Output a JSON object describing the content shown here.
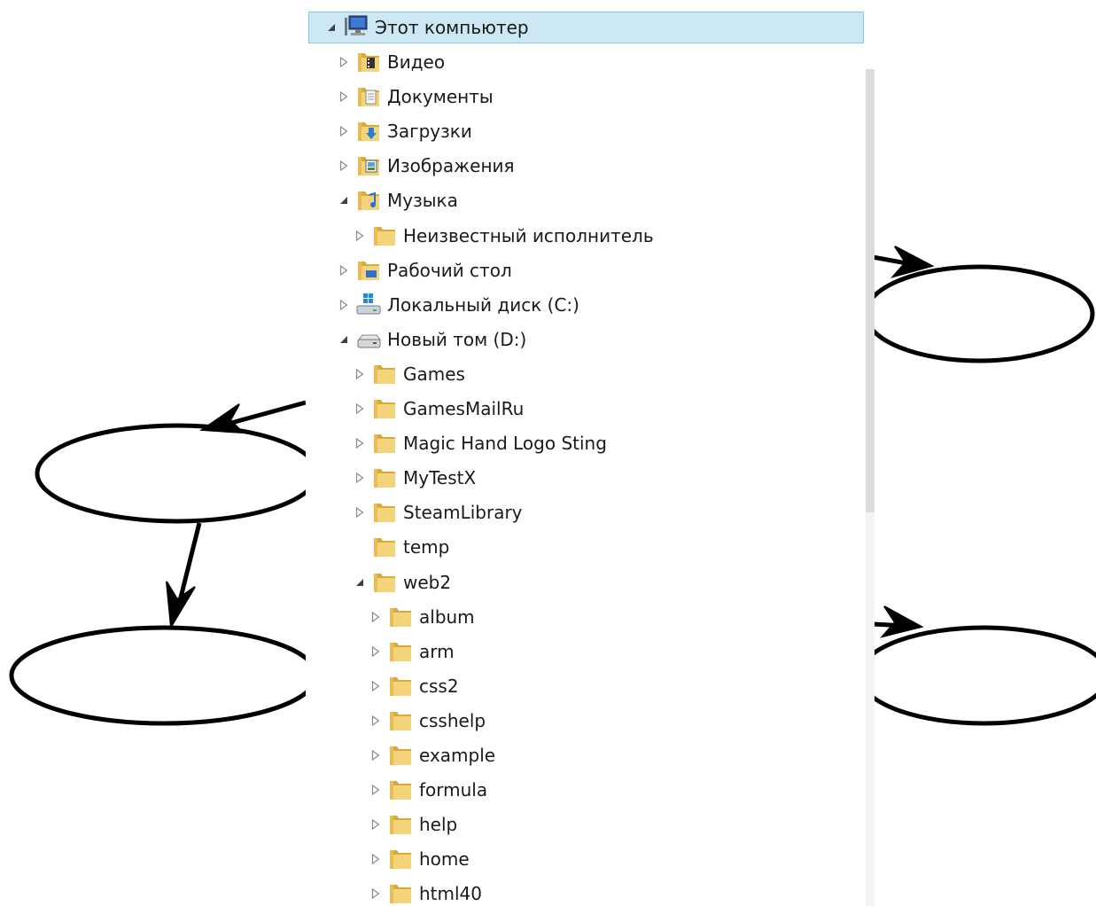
{
  "tree": {
    "root": {
      "label": "Этот компьютер",
      "icon": "computer-icon",
      "expanded": true
    },
    "items": [
      {
        "label": "Видео",
        "icon": "video-folder-icon",
        "arrow": "collapsed"
      },
      {
        "label": "Документы",
        "icon": "documents-folder-icon",
        "arrow": "collapsed"
      },
      {
        "label": "Загрузки",
        "icon": "downloads-folder-icon",
        "arrow": "collapsed"
      },
      {
        "label": "Изображения",
        "icon": "pictures-folder-icon",
        "arrow": "collapsed"
      },
      {
        "label": "Музыка",
        "icon": "music-folder-icon",
        "arrow": "expanded"
      },
      {
        "label": "Неизвестный исполнитель",
        "icon": "folder-icon",
        "arrow": "collapsed"
      },
      {
        "label": "Рабочий стол",
        "icon": "desktop-folder-icon",
        "arrow": "collapsed"
      },
      {
        "label": "Локальный диск (C:)",
        "icon": "system-drive-icon",
        "arrow": "collapsed"
      },
      {
        "label": "Новый том (D:)",
        "icon": "drive-icon",
        "arrow": "expanded"
      },
      {
        "label": "Games",
        "icon": "folder-icon",
        "arrow": "collapsed"
      },
      {
        "label": "GamesMailRu",
        "icon": "folder-icon",
        "arrow": "collapsed"
      },
      {
        "label": "Magic Hand Logo Sting",
        "icon": "folder-icon",
        "arrow": "collapsed"
      },
      {
        "label": "MyTestX",
        "icon": "folder-icon",
        "arrow": "collapsed"
      },
      {
        "label": "SteamLibrary",
        "icon": "folder-icon",
        "arrow": "collapsed"
      },
      {
        "label": "temp",
        "icon": "folder-icon",
        "arrow": "none"
      },
      {
        "label": "web2",
        "icon": "folder-icon",
        "arrow": "expanded"
      },
      {
        "label": "album",
        "icon": "folder-icon",
        "arrow": "collapsed"
      },
      {
        "label": "arm",
        "icon": "folder-icon",
        "arrow": "collapsed"
      },
      {
        "label": "css2",
        "icon": "folder-icon",
        "arrow": "collapsed"
      },
      {
        "label": "csshelp",
        "icon": "folder-icon",
        "arrow": "collapsed"
      },
      {
        "label": "example",
        "icon": "folder-icon",
        "arrow": "collapsed"
      },
      {
        "label": "formula",
        "icon": "folder-icon",
        "arrow": "collapsed"
      },
      {
        "label": "help",
        "icon": "folder-icon",
        "arrow": "collapsed"
      },
      {
        "label": "home",
        "icon": "folder-icon",
        "arrow": "collapsed"
      },
      {
        "label": "html40",
        "icon": "folder-icon",
        "arrow": "collapsed"
      }
    ]
  },
  "colors": {
    "selection_bg": "#cce8f5",
    "selection_border": "#8cc8e6",
    "text": "#1a1a1a",
    "folder": "#e8c25a"
  }
}
